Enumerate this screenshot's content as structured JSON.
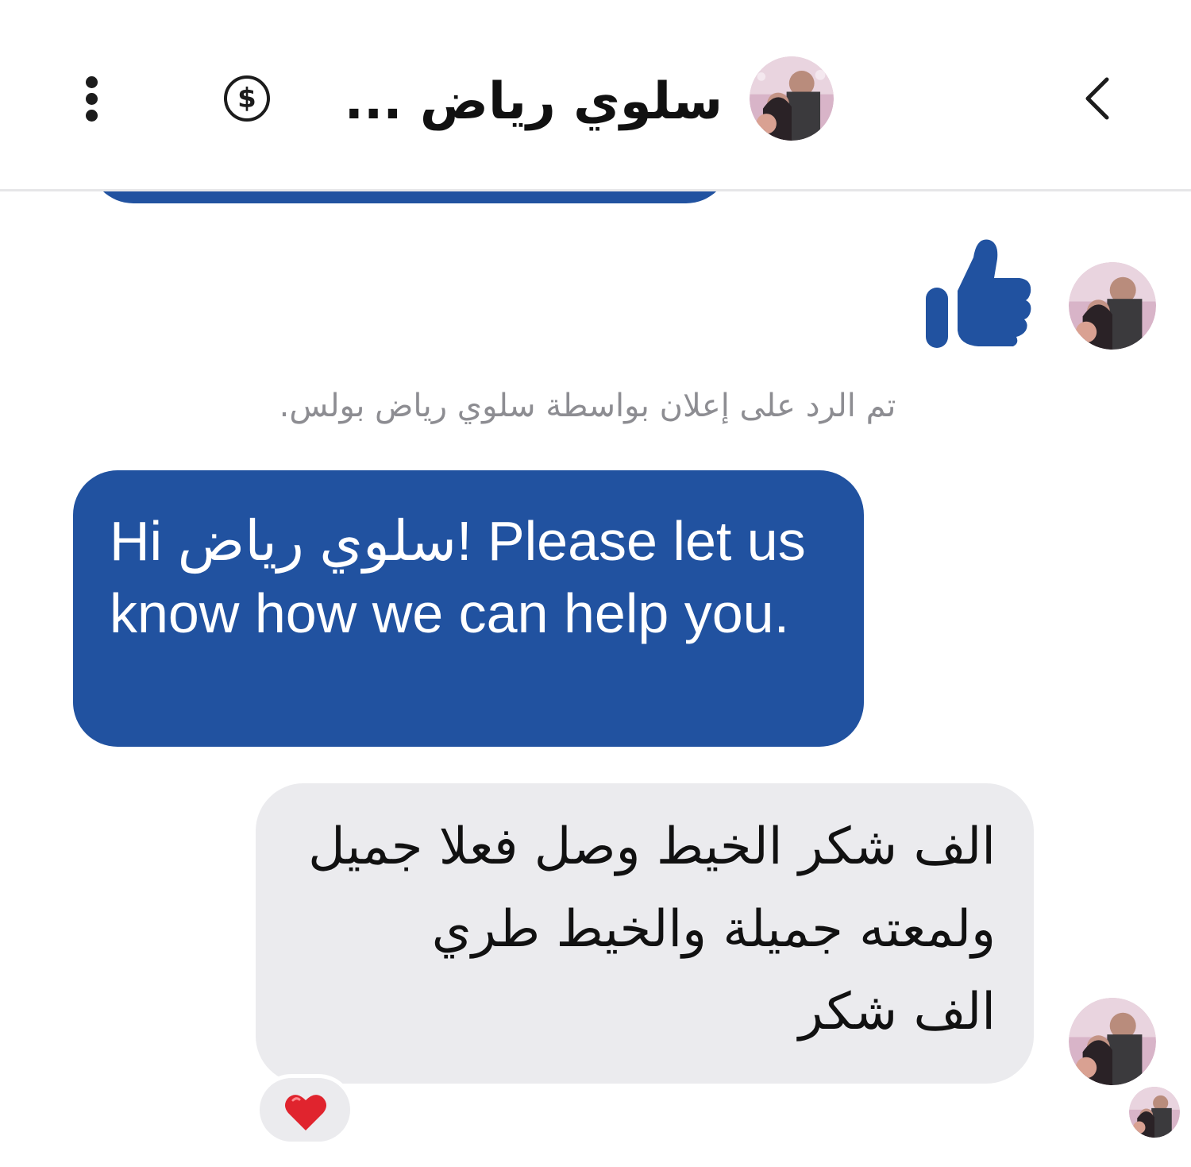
{
  "header": {
    "contact_name": "سلوي رياض ...",
    "menu_icon": "more-vertical-icon",
    "payment_icon": "dollar-circle-icon",
    "back_icon": "chevron-left-icon"
  },
  "conversation": {
    "sent_sticker": "thumbs-up-icon",
    "ad_reply_note": "تم الرد على إعلان بواسطة سلوي رياض بولس.",
    "messages": [
      {
        "direction": "outgoing",
        "text": "Hi سلوي رياض! Please let us know how we can help you."
      },
      {
        "direction": "incoming",
        "lines": [
          "الف شكر الخيط وصل فعلا جميل",
          "ولمعته جميلة والخيط طري",
          "الف شكر"
        ],
        "reaction": "heart-icon"
      }
    ]
  },
  "colors": {
    "brand_blue": "#2152a0",
    "incoming_bubble": "#ebebee",
    "note_gray": "#8d8d92"
  }
}
